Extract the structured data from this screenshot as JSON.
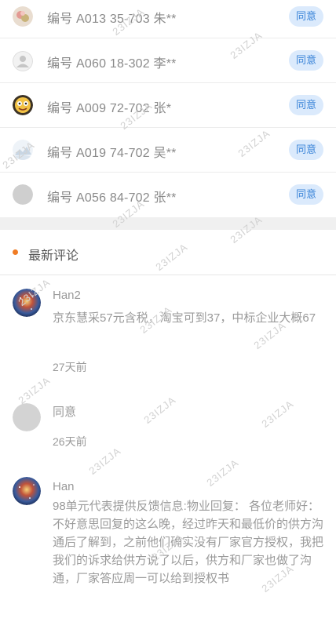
{
  "votes": [
    {
      "label": "编号 A013 35-703 朱**",
      "action": "同意",
      "avatar": "avatar-floral"
    },
    {
      "label": "编号 A060 18-302 李**",
      "action": "同意",
      "avatar": "avatar-default"
    },
    {
      "label": "编号 A009 72-702 张*",
      "action": "同意",
      "avatar": "avatar-cartoon"
    },
    {
      "label": "编号 A019 74-702 吴**",
      "action": "同意",
      "avatar": "avatar-snow"
    },
    {
      "label": "编号 A056 84-702 张**",
      "action": "同意",
      "avatar": "avatar-gray"
    }
  ],
  "section": {
    "title": "最新评论"
  },
  "comments": [
    {
      "name": "Han2",
      "content": "京东慧采57元含税，淘宝可到37，中标企业大概67",
      "time": "27天前",
      "avatar": "avatar-galaxy"
    },
    {
      "name": "",
      "content": "同意",
      "time": "26天前",
      "avatar": "avatar-gray"
    },
    {
      "name": "Han",
      "content": "98单元代表提供反馈信息:物业回复： 各位老师好： 不好意思回复的这么晚，经过昨天和最低价的供方沟通后了解到，之前他们确实没有厂家官方授权，我把我们的诉求给供方说了以后，供方和厂家也做了沟通，厂家答应周一可以给到授权书",
      "time": "",
      "avatar": "avatar-galaxy"
    }
  ],
  "watermark": "23IZJA",
  "colors": {
    "accent_dot": "#f07c24",
    "agree_bg": "#dbeafc",
    "agree_text": "#3a84d8"
  }
}
